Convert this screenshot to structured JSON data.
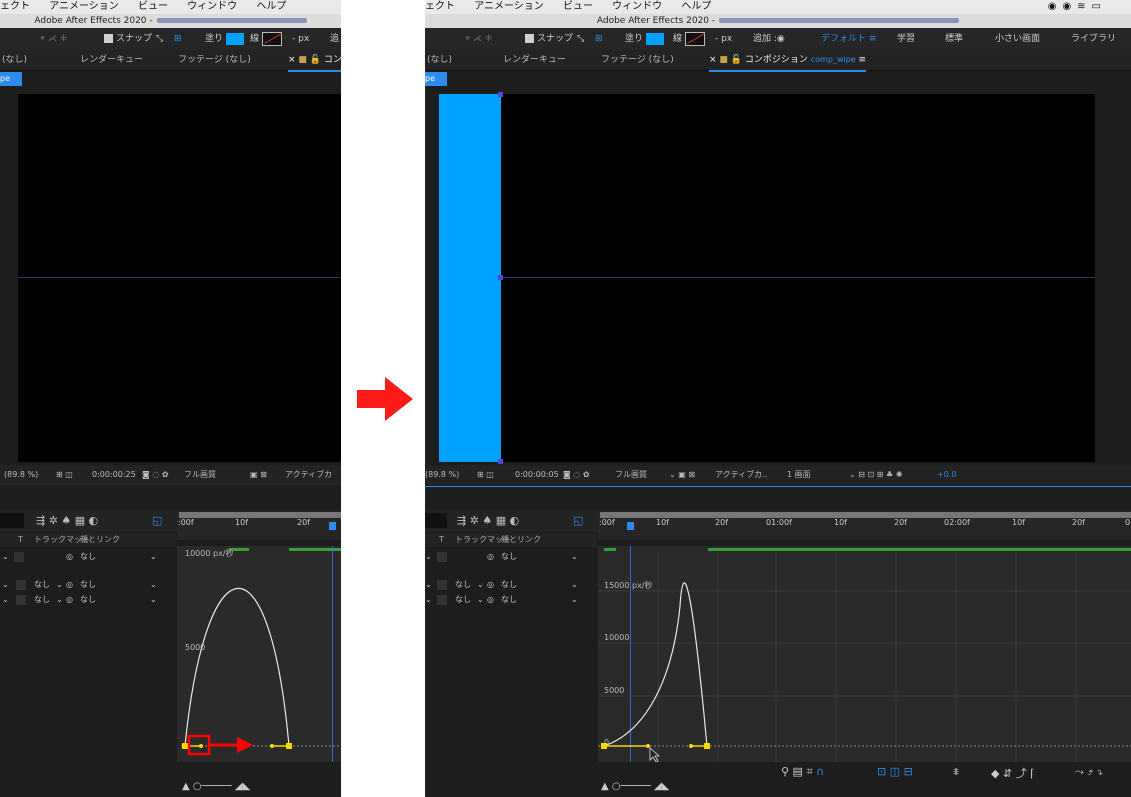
{
  "left": {
    "menu": [
      "ェクト",
      "アニメーション",
      "ビュー",
      "ウィンドウ",
      "ヘルプ"
    ],
    "window_title": "Adobe After Effects 2020 -",
    "toolbar": {
      "snap": "スナップ",
      "fill": "塗り",
      "stroke": "線",
      "px": "- px",
      "add": "追"
    },
    "tabs": {
      "none": "(なし)",
      "render_queue": "レンダーキュー",
      "footage": "フッテージ (なし)",
      "comp": "コン"
    },
    "comp_tab": "pe",
    "viewer_bar": {
      "zoom": "(89.8 %)",
      "time": "0:00:00:25",
      "quality": "フル画質",
      "active": "アクティブカ"
    },
    "layer_header": {
      "t": "T",
      "trackmatte": "トラックマット",
      "parent": "親とリンク"
    },
    "rows": [
      {
        "parent": "なし"
      },
      {
        "matte": "なし",
        "parent": "なし"
      },
      {
        "matte": "なし",
        "parent": "なし"
      }
    ],
    "ruler_labels": [
      ":00f",
      "10f",
      "20f"
    ],
    "y_labels": [
      "10000 px/秒",
      "5000"
    ]
  },
  "right": {
    "menu": [
      "ェクト",
      "アニメーション",
      "ビュー",
      "ウィンドウ",
      "ヘルプ"
    ],
    "window_title": "Adobe After Effects 2020 -",
    "toolbar": {
      "snap": "スナップ",
      "fill": "塗り",
      "stroke": "線",
      "px": "- px",
      "add": "追加 :",
      "workspace": "デフォルト",
      "learn": "学習",
      "standard": "標準",
      "small": "小さい画面",
      "library": "ライブラリ"
    },
    "tabs": {
      "none": "(なし)",
      "render_queue": "レンダーキュー",
      "footage": "フッテージ (なし)",
      "comp_label": "コンポジション",
      "comp_name": "comp_wipe"
    },
    "comp_tab": "pe",
    "viewer_bar": {
      "zoom": "(89.8 %)",
      "time": "0:00:00:05",
      "quality": "フル画質",
      "active": "アクティブカ..",
      "view": "1 画面",
      "offset": "+0.0"
    },
    "layer_header": {
      "t": "T",
      "trackmatte": "トラックマット",
      "parent": "親とリンク"
    },
    "rows": [
      {
        "parent": "なし"
      },
      {
        "matte": "なし",
        "parent": "なし"
      },
      {
        "matte": "なし",
        "parent": "なし"
      }
    ],
    "ruler_labels": [
      ":00f",
      "10f",
      "20f",
      "01:00f",
      "10f",
      "20f",
      "02:00f",
      "10f",
      "20f",
      "0"
    ],
    "y_labels": [
      "15000 px/秒",
      "10000",
      "5000",
      "0"
    ]
  },
  "colors": {
    "accent": "#2d8ceb",
    "shape_fill": "#00a2ff",
    "keyframe": "#f5d800",
    "arrow": "#ff0000"
  },
  "icons": [
    "magnet-icon",
    "camera-icon",
    "graph-editor-icon",
    "fit-icon"
  ]
}
